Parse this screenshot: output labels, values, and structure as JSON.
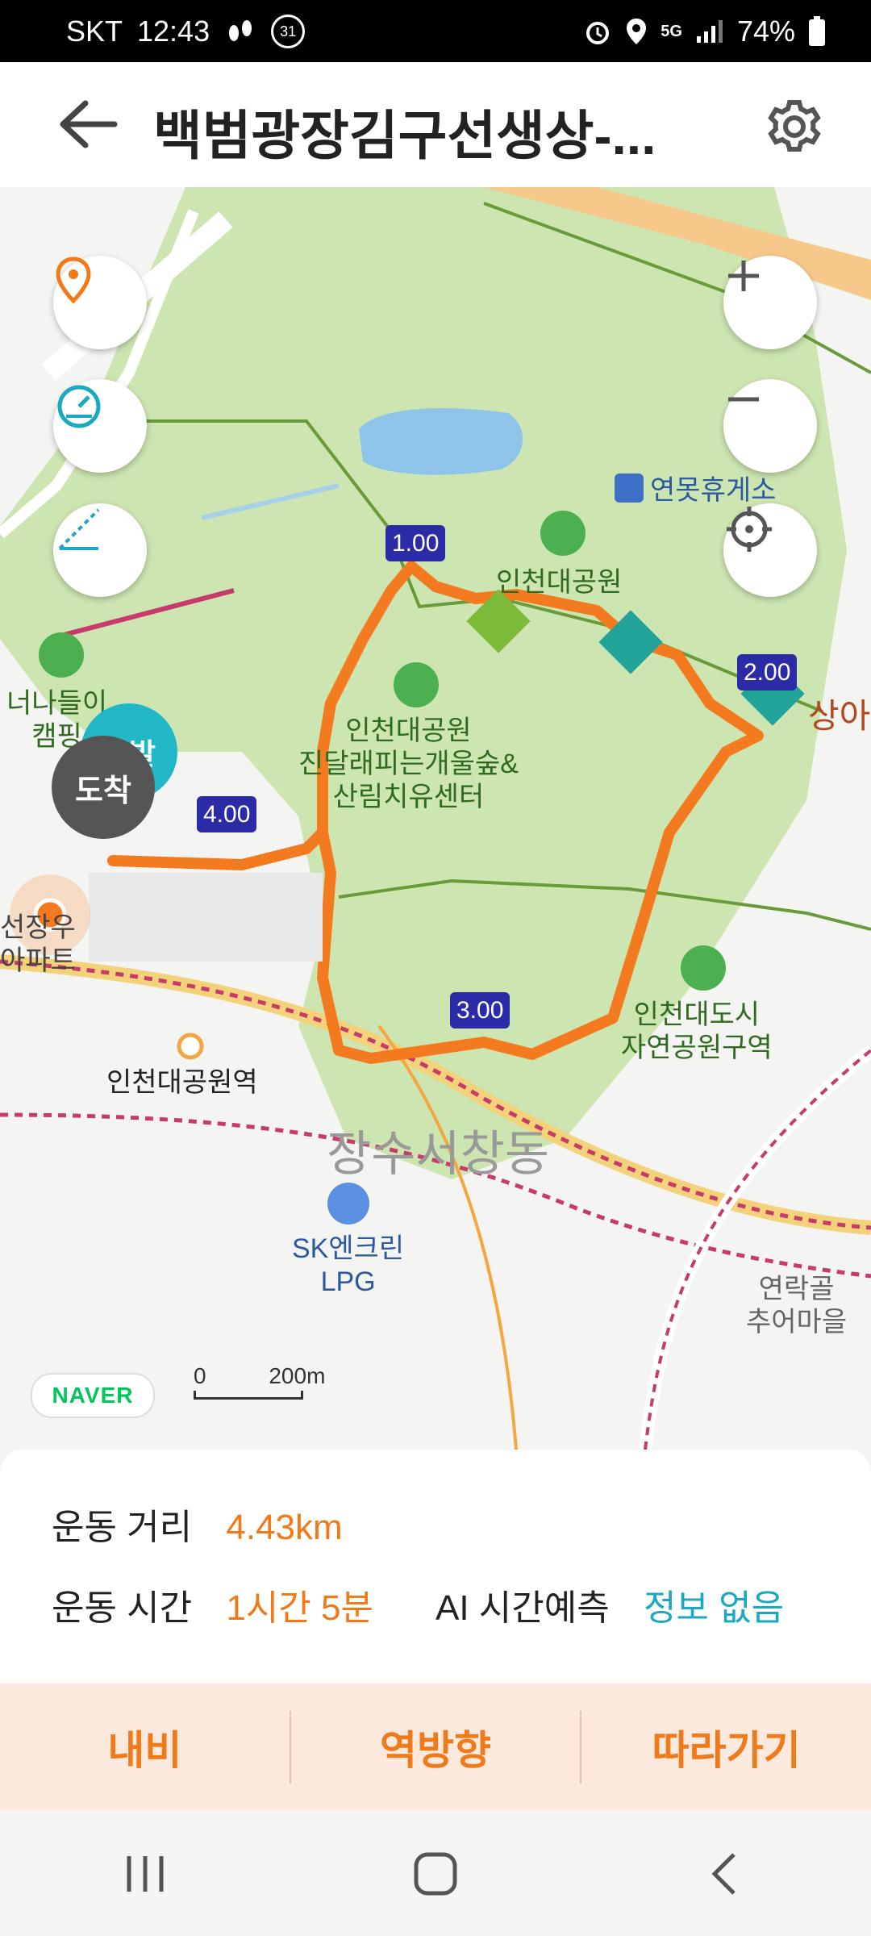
{
  "status_bar": {
    "carrier": "SKT",
    "time": "12:43",
    "date_badge": "31",
    "battery": "74%",
    "network": "5G"
  },
  "header": {
    "title": "백범광장김구선생상-...",
    "back_icon": "arrow-left-icon",
    "settings_icon": "gear-icon"
  },
  "map": {
    "labels": {
      "rest_area": "연못휴게소",
      "park": "인천대공원",
      "forest_center": "인천대공원\n진달래피는개울숲&\n산림치유센터",
      "camping": "너나들이\n캠핑",
      "station": "인천대공원역",
      "district": "장수서창동",
      "gas_station": "SK엔크린\nLPG",
      "nature_park": "인천대도시\n자연공원구역",
      "village": "연락골\n추어마을",
      "apartment": "선장우\n아파트",
      "right_edge": "상아",
      "arrival_badge": "도착",
      "start_badge": "출발"
    },
    "km_markers": [
      "1.00",
      "2.00",
      "3.00",
      "4.00"
    ],
    "naver_logo": "NAVER",
    "scale_zero": "0",
    "scale_label": "200m"
  },
  "info": {
    "distance_label": "운동 거리",
    "distance_value": "4.43km",
    "time_label": "운동 시간",
    "time_value": "1시간 5분",
    "ai_label": "AI 시간예측",
    "ai_value": "정보 없음"
  },
  "actions": {
    "navi": "내비",
    "reverse": "역방향",
    "follow": "따라가기"
  },
  "colors": {
    "accent": "#f07a1a",
    "teal": "#1aa9c0",
    "park_green": "#cfe6b4",
    "route": "#f47a20"
  }
}
